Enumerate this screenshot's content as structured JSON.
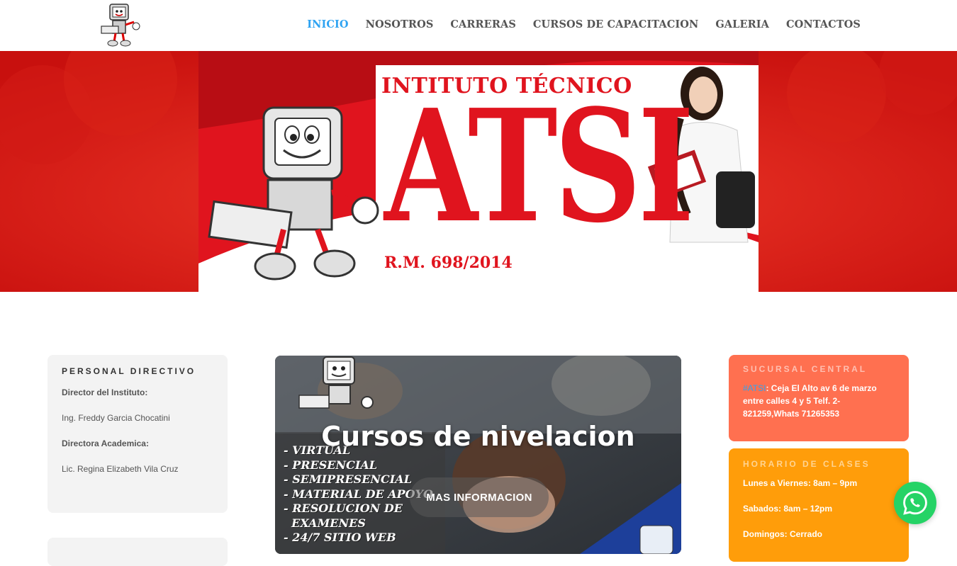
{
  "header": {
    "nav": [
      {
        "label": "INICIO",
        "active": true
      },
      {
        "label": "NOSOTROS",
        "active": false
      },
      {
        "label": "CARRERAS",
        "active": false
      },
      {
        "label": "CURSOS DE CAPACITACION",
        "active": false
      },
      {
        "label": "GALERIA",
        "active": false
      },
      {
        "label": "CONTACTOS",
        "active": false
      }
    ],
    "logo_icon": "computer-mascot-icon"
  },
  "hero": {
    "title": "INTITUTO TÉCNICO",
    "brand": "ATSI",
    "rm": "R.M. 698/2014"
  },
  "personal": {
    "title": "PERSONAL DIRECTIVO",
    "director_label": "Director del Instituto:",
    "director_name": "Ing. Freddy Garcia Chocatini",
    "academic_label": "Directora Academica:",
    "academic_name": "Lic. Regina Elizabeth Vila Cruz"
  },
  "promo": {
    "title": "Cursos de nivelacion",
    "list": [
      "- VIRTUAL",
      "- PRESENCIAL",
      "- SEMIPRESENCIAL",
      "- MATERIAL DE APOYO",
      "- RESOLUCION DE",
      "  EXAMENES",
      "- 24/7 SITIO WEB"
    ],
    "button": "MAS INFORMACION"
  },
  "sucursal": {
    "title": "SUCURSAL CENTRAL",
    "hashtag": "#ATSI",
    "text": ": Ceja El Alto av 6 de marzo entre calles 4 y 5 Telf. 2-821259,Whats 71265353"
  },
  "horario": {
    "title": "HORARIO DE CLASES",
    "weekdays": "Lunes a Viernes: 8am – 9pm",
    "saturday": "Sabados: 8am – 12pm",
    "sunday": "Domingos: Cerrado"
  },
  "colors": {
    "accent": "#2ea3f2",
    "red": "#e0141e",
    "coral": "#ff7050",
    "orange": "#ff9d0a",
    "whatsapp": "#25d366"
  },
  "whatsapp_icon": "whatsapp-icon"
}
